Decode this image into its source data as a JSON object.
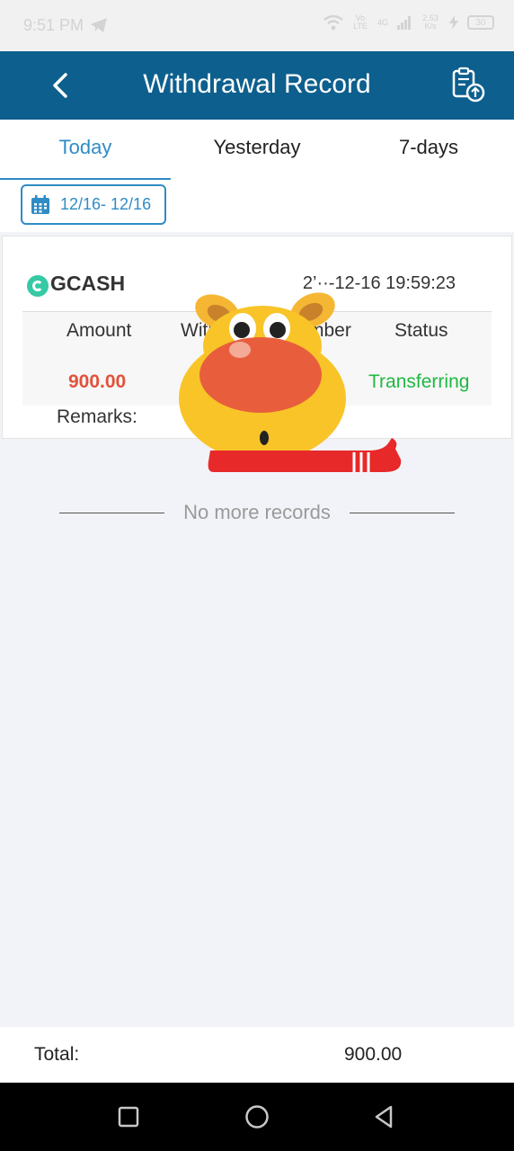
{
  "status_bar": {
    "time": "9:51 PM",
    "network_small_1": "Vo LTE",
    "network_gen": "4G",
    "speed": "2.53 K/s",
    "battery": "30"
  },
  "header": {
    "title": "Withdrawal Record"
  },
  "tabs": [
    {
      "label": "Today",
      "active": true
    },
    {
      "label": "Yesterday",
      "active": false
    },
    {
      "label": "7-days",
      "active": false
    }
  ],
  "filter": {
    "date_range": "12/16- 12/16"
  },
  "record": {
    "method": "GCASH",
    "time": "2’··-12-16 19:59:23",
    "columns": {
      "amount": "Amount",
      "withdraw_number": "Witł",
      "withdraw_number_tail": "mber",
      "status": "Status"
    },
    "values": {
      "amount": "900.00",
      "status": "Transferring"
    },
    "remarks_label": "Remarks:"
  },
  "no_more": "No more records",
  "footer": {
    "total_label": "Total:",
    "total_value": "900.00"
  },
  "colors": {
    "header_bg": "#0d5f8e",
    "accent": "#2f8cc4",
    "amount": "#e2523c",
    "status": "#1fb842"
  },
  "icons": [
    "back-icon",
    "export-record-icon",
    "calendar-icon",
    "gcash-logo",
    "mascot",
    "square-nav-icon",
    "circle-nav-icon",
    "triangle-nav-icon"
  ]
}
